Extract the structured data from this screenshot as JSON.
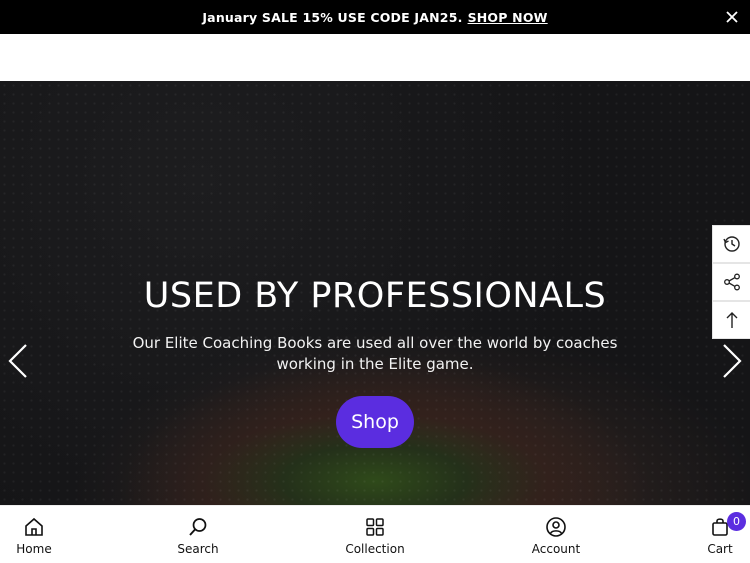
{
  "announcement": {
    "text": "January SALE 15% USE CODE JAN25.",
    "link_label": "SHOP NOW"
  },
  "hero": {
    "title": "USED BY PROFESSIONALS",
    "subtitle": "Our Elite Coaching Books are used all over the world by coaches working in the Elite game.",
    "button_label": "Shop"
  },
  "side_tools": [
    {
      "icon": "recently-viewed-icon"
    },
    {
      "icon": "share-icon"
    },
    {
      "icon": "back-to-top-icon"
    }
  ],
  "bottom_nav": {
    "home": "Home",
    "search": "Search",
    "collection": "Collection",
    "account": "Account",
    "cart": "Cart",
    "cart_count": "0"
  },
  "colors": {
    "accent": "#5b2de0",
    "announcement_bg": "#000000"
  }
}
